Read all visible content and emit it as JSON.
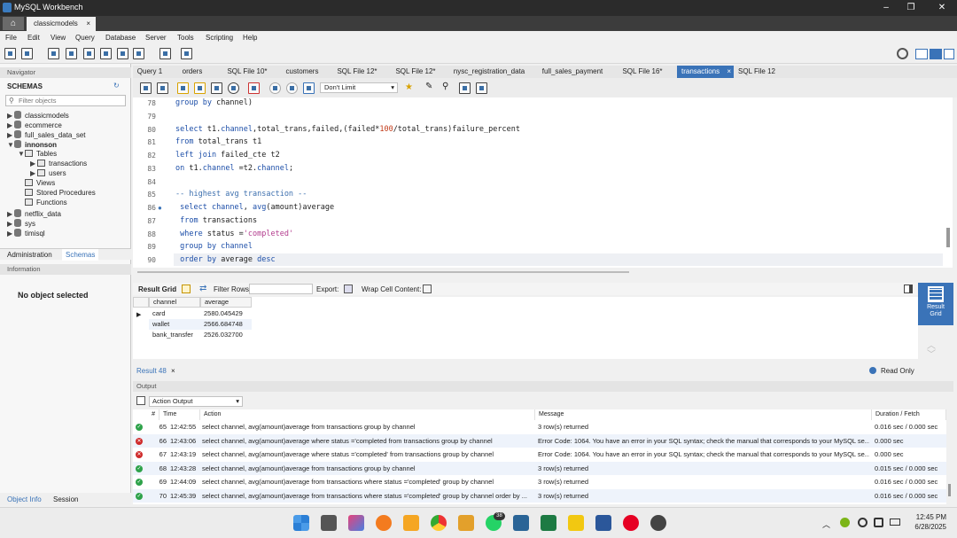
{
  "window": {
    "title": "MySQL Workbench",
    "connection_tab": "classicmodels"
  },
  "menu": [
    "File",
    "Edit",
    "View",
    "Query",
    "Database",
    "Server",
    "Tools",
    "Scripting",
    "Help"
  ],
  "navigator": {
    "header": "Navigator",
    "schemas_label": "SCHEMAS",
    "filter_placeholder": "Filter objects",
    "schemas": [
      "classicmodels",
      "ecommerce",
      "full_sales_data_set",
      "innonson",
      "netflix_data",
      "sys",
      "timisql"
    ],
    "innonson_children": {
      "tables": "Tables",
      "table_items": [
        "transactions",
        "users"
      ],
      "views": "Views",
      "procs": "Stored Procedures",
      "funcs": "Functions"
    },
    "tabs": [
      "Administration",
      "Schemas"
    ],
    "info_header": "Information",
    "no_object": "No object selected",
    "bottom_tabs": [
      "Object Info",
      "Session"
    ]
  },
  "editor_tabs": [
    "Query 1",
    "orders",
    "SQL File 10*",
    "customers",
    "SQL File 12*",
    "SQL File 12*",
    "nysc_registration_data",
    "full_sales_payment",
    "SQL File 16*",
    "transactions",
    "SQL File 12"
  ],
  "active_tab_close": "×",
  "limit": "Don't Limit",
  "code_lines": [
    {
      "n": "78",
      "t": "group by channel)"
    },
    {
      "n": "79",
      "t": ""
    },
    {
      "n": "80",
      "t": "select t1.channel,total_trans,failed,(failed*100/total_trans)failure_percent"
    },
    {
      "n": "81",
      "t": "from total_trans t1"
    },
    {
      "n": "82",
      "t": "left join failed_cte t2"
    },
    {
      "n": "83",
      "t": "on t1.channel =t2.channel;"
    },
    {
      "n": "84",
      "t": ""
    },
    {
      "n": "85",
      "t": "-- highest avg transaction --"
    },
    {
      "n": "86",
      "t": " select channel, avg(amount)average"
    },
    {
      "n": "87",
      "t": " from transactions"
    },
    {
      "n": "88",
      "t": " where status ='completed'"
    },
    {
      "n": "89",
      "t": " group by channel"
    },
    {
      "n": "90",
      "t": " order by average desc"
    }
  ],
  "result": {
    "toolbar": {
      "grid": "Result Grid",
      "filter": "Filter Rows:",
      "export": "Export:",
      "wrap": "Wrap Cell Content:"
    },
    "columns": [
      "channel",
      "average"
    ],
    "rows": [
      [
        "card",
        "2580.045429"
      ],
      [
        "wallet",
        "2566.684748"
      ],
      [
        "bank_transfer",
        "2526.032700"
      ]
    ],
    "tab": "Result 48",
    "readonly": "Read Only",
    "side_btn": "Result Grid"
  },
  "output": {
    "header": "Output",
    "selector": "Action Output",
    "columns": [
      "#",
      "Time",
      "Action",
      "Message",
      "Duration / Fetch"
    ],
    "rows": [
      {
        "s": "ok",
        "n": "65",
        "time": "12:42:55",
        "action": "select channel, avg(amount)average  from transactions  group by channel",
        "msg": "3 row(s) returned",
        "dur": "0.016 sec / 0.000 sec"
      },
      {
        "s": "err",
        "n": "66",
        "time": "12:43:06",
        "action": "select channel, avg(amount)average   where status ='completed  from transactions  group by channel",
        "msg": "Error Code: 1064. You have an error in your SQL syntax; check the manual that corresponds to your MySQL se...",
        "dur": "0.000 sec"
      },
      {
        "s": "err",
        "n": "67",
        "time": "12:43:19",
        "action": "select channel, avg(amount)average   where status ='completed'  from transactions  group by channel",
        "msg": "Error Code: 1064. You have an error in your SQL syntax; check the manual that corresponds to your MySQL se...",
        "dur": "0.000 sec"
      },
      {
        "s": "ok",
        "n": "68",
        "time": "12:43:28",
        "action": "select channel, avg(amount)average  from transactions  group by channel",
        "msg": "3 row(s) returned",
        "dur": "0.015 sec / 0.000 sec"
      },
      {
        "s": "ok",
        "n": "69",
        "time": "12:44:09",
        "action": "select channel, avg(amount)average  from transactions  where status ='completed'  group by channel",
        "msg": "3 row(s) returned",
        "dur": "0.016 sec / 0.000 sec"
      },
      {
        "s": "ok",
        "n": "70",
        "time": "12:45:39",
        "action": "select channel, avg(amount)average  from transactions  where status ='completed'  group by channel  order by ...",
        "msg": "3 row(s) returned",
        "dur": "0.016 sec / 0.000 sec"
      }
    ]
  },
  "taskbar": {
    "time": "12:45 PM",
    "date": "6/28/2025",
    "badge": "38"
  },
  "colors": {
    "accent": "#3a73b8",
    "ok": "#2ea24a",
    "error": "#cf2b2b"
  }
}
